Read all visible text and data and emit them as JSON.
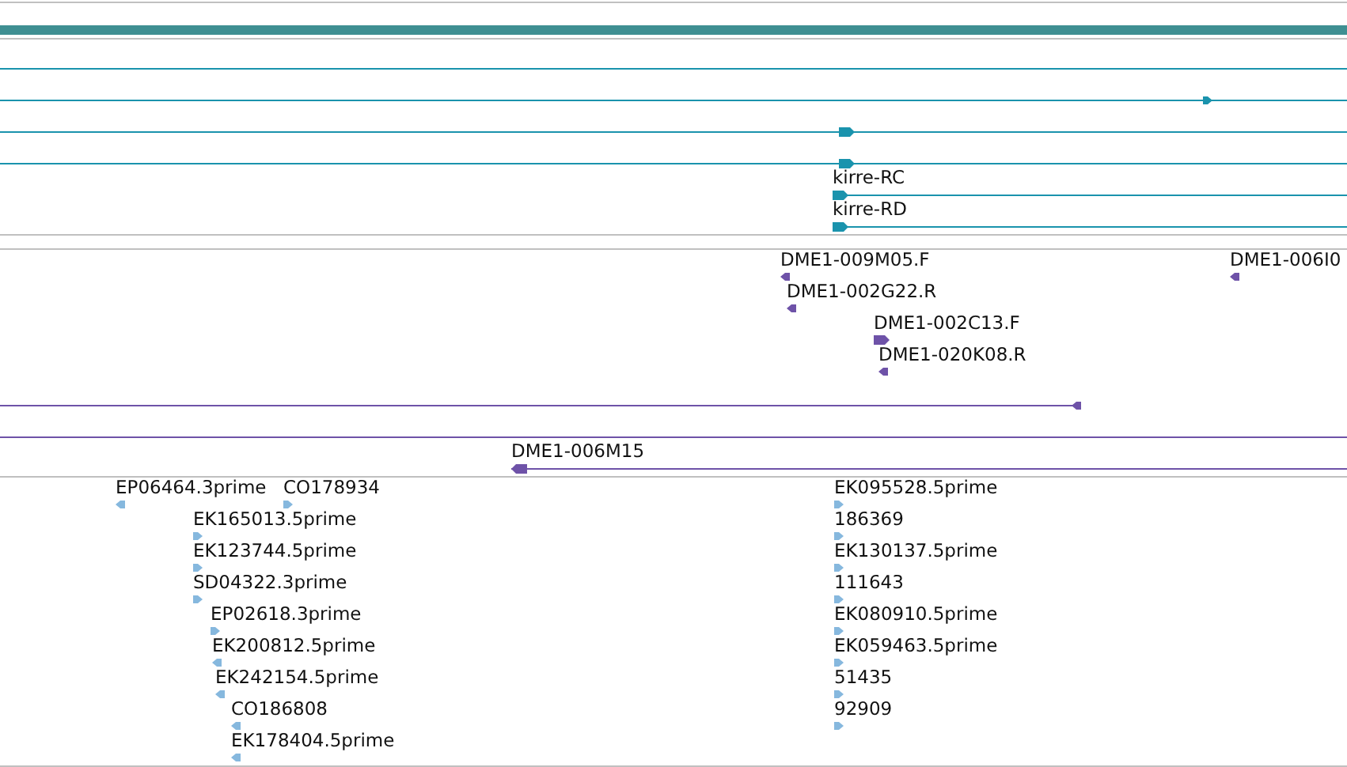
{
  "tracks": [
    {
      "kind": "gene",
      "color": "#1a93ad",
      "features": [
        {
          "arrow": false
        },
        {
          "reverse": false
        },
        {
          "reverse": false
        },
        {
          "reverse": false
        },
        {
          "label": "kirre-RC",
          "reverse": false
        },
        {
          "label": "kirre-RD",
          "reverse": false
        }
      ]
    },
    {
      "kind": "clone",
      "color": "#6e52a8",
      "features": [
        {
          "label": "DME1-009M05.F",
          "reverse": true
        },
        {
          "label": "DME1-002G22.R",
          "reverse": true
        },
        {
          "label": "DME1-002C13.F",
          "reverse": false
        },
        {
          "label": "DME1-020K08.R",
          "reverse": true
        },
        {
          "reverse": true
        },
        {
          "arrow": false
        },
        {
          "label": "DME1-006M15",
          "reverse": true
        },
        {
          "label": "DME1-006I0",
          "reverse": true
        }
      ]
    },
    {
      "kind": "est",
      "color": "#86b8de",
      "features": [
        {
          "label": "EP06464.3prime",
          "reverse": true
        },
        {
          "label": "CO178934",
          "reverse": false
        },
        {
          "label": "EK165013.5prime",
          "reverse": false
        },
        {
          "label": "EK123744.5prime",
          "reverse": false
        },
        {
          "label": "SD04322.3prime",
          "reverse": false
        },
        {
          "label": "EP02618.3prime",
          "reverse": false
        },
        {
          "label": "EK200812.5prime",
          "reverse": true
        },
        {
          "label": "EK242154.5prime",
          "reverse": true
        },
        {
          "label": "CO186808",
          "reverse": true
        },
        {
          "label": "EK178404.5prime",
          "reverse": true
        },
        {
          "label": "EK095528.5prime",
          "reverse": false
        },
        {
          "label": "186369",
          "reverse": false
        },
        {
          "label": "EK130137.5prime",
          "reverse": false
        },
        {
          "label": "111643",
          "reverse": false
        },
        {
          "label": "EK080910.5prime",
          "reverse": false
        },
        {
          "label": "EK059463.5prime",
          "reverse": false
        },
        {
          "label": "51435",
          "reverse": false
        },
        {
          "label": "92909",
          "reverse": false
        }
      ]
    }
  ]
}
